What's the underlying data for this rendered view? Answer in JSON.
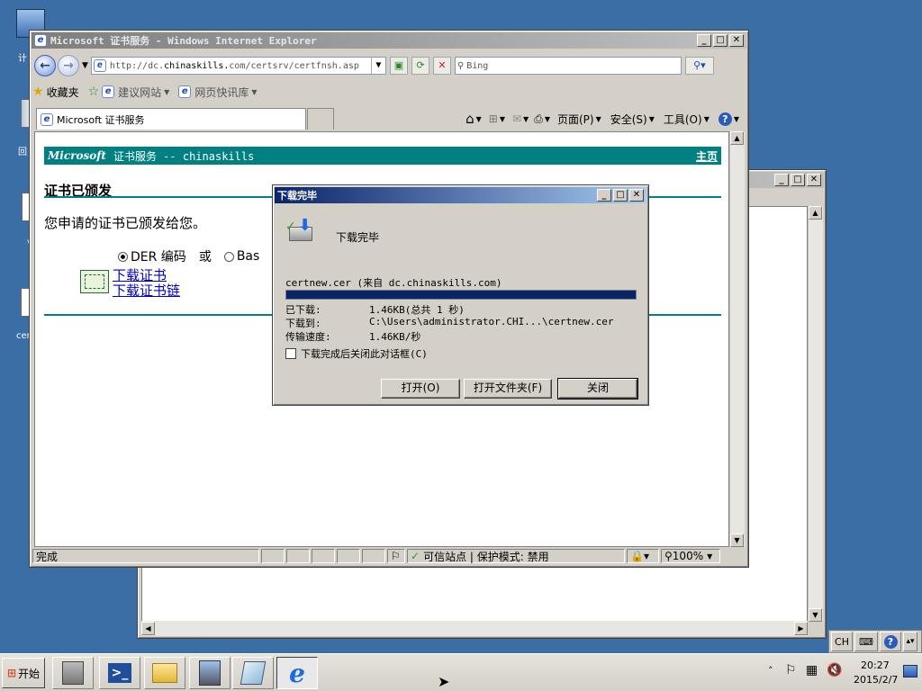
{
  "desktop": {
    "icon_labels": [
      "计",
      "回",
      "v",
      "cer"
    ]
  },
  "bg_window": {
    "btn_min": "_",
    "btn_max": "□",
    "btn_close": "✕"
  },
  "ie": {
    "title": "Microsoft 证书服务 - Windows Internet Explorer",
    "btn_min": "_",
    "btn_max": "□",
    "btn_close": "✕",
    "address_prefix": "http://dc.",
    "address_domain": "chinaskills.",
    "address_suffix": "com/certsrv/certfnsh.asp",
    "search_placeholder": "Bing",
    "favorites_label": "收藏夹",
    "fav_suggested": "建议网站",
    "fav_webslice": "网页快讯库",
    "tab_title": "Microsoft 证书服务",
    "cmd_page": "页面(P)",
    "cmd_safety": "安全(S)",
    "cmd_tools": "工具(O)",
    "status_done": "完成",
    "status_zone": "可信站点 | 保护模式: 禁用",
    "zoom": "100%"
  },
  "page": {
    "brand": "Microsoft",
    "header_text": "证书服务 -- chinaskills",
    "home_link": "主页",
    "heading": "证书已颁发",
    "message": "您申请的证书已颁发给您。",
    "der_label": "DER 编码",
    "or_label": "或",
    "base_label": "Bas",
    "download_cert": "下载证书",
    "download_chain": "下载证书链"
  },
  "dialog": {
    "title": "下载完毕",
    "heading": "下载完毕",
    "file_line": "certnew.cer (来自 dc.chinaskills.com)",
    "progress": 1.0,
    "downloaded_label": "已下载:",
    "downloaded_value": "1.46KB(总共 1 秒)",
    "saved_to_label": "下载到:",
    "saved_to_value": "C:\\Users\\administrator.CHI...\\certnew.cer",
    "speed_label": "传输速度:",
    "speed_value": "1.46KB/秒",
    "close_when_done": "下载完成后关闭此对话框(C)",
    "btn_open": "打开(O)",
    "btn_open_folder": "打开文件夹(F)",
    "btn_close": "关闭"
  },
  "taskbar": {
    "start_label": "开始",
    "lang": "CH",
    "time": "20:27",
    "date": "2015/2/7"
  },
  "colors": {
    "desktop": "#3a6ea5",
    "ms_teal": "#008080",
    "progress": "#0a246a"
  }
}
